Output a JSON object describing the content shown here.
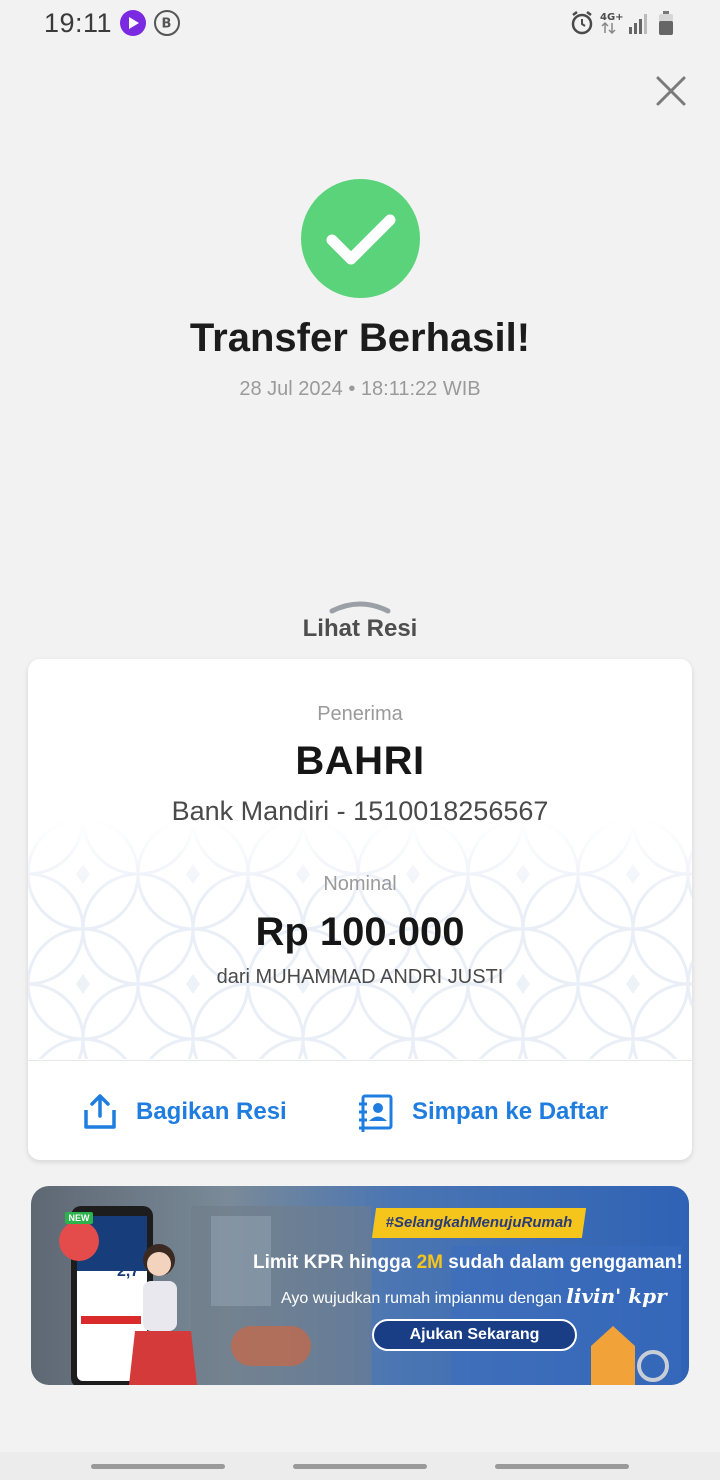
{
  "status_bar": {
    "time": "19:11",
    "network": "4G+",
    "icons": [
      "play-app-icon",
      "b-app-icon",
      "alarm-icon",
      "network-arrows-icon",
      "signal-icon",
      "battery-icon"
    ]
  },
  "header": {
    "close_icon": "close-icon"
  },
  "success": {
    "icon": "checkmark-icon",
    "icon_color": "#5ad37a",
    "title": "Transfer Berhasil!",
    "datetime": "28 Jul 2024 • 18:11:22 WIB"
  },
  "receipt_toggle": {
    "label": "Lihat Resi",
    "icon": "chevron-up-icon"
  },
  "receipt": {
    "recipient_label": "Penerima",
    "recipient_name": "BAHRI",
    "recipient_account": "Bank Mandiri - 1510018256567",
    "amount_label": "Nominal",
    "amount": "Rp 100.000",
    "sender": "dari MUHAMMAD ANDRI JUSTI"
  },
  "actions": {
    "share_label": "Bagikan Resi",
    "share_icon": "share-icon",
    "save_label": "Simpan ke Daftar",
    "save_icon": "contact-add-icon",
    "accent_color": "#1f7de0"
  },
  "banner": {
    "hashtag": "#SelangkahMenujuRumah",
    "headline_prefix": "Limit KPR hingga ",
    "headline_highlight": "2M",
    "headline_suffix": " sudah dalam genggaman!",
    "subline": "Ayo wujudkan rumah impianmu dengan ",
    "brand": "livin' kpr",
    "cta": "Ajukan Sekarang",
    "badge": "NEW",
    "phone_rate": "2,7"
  }
}
